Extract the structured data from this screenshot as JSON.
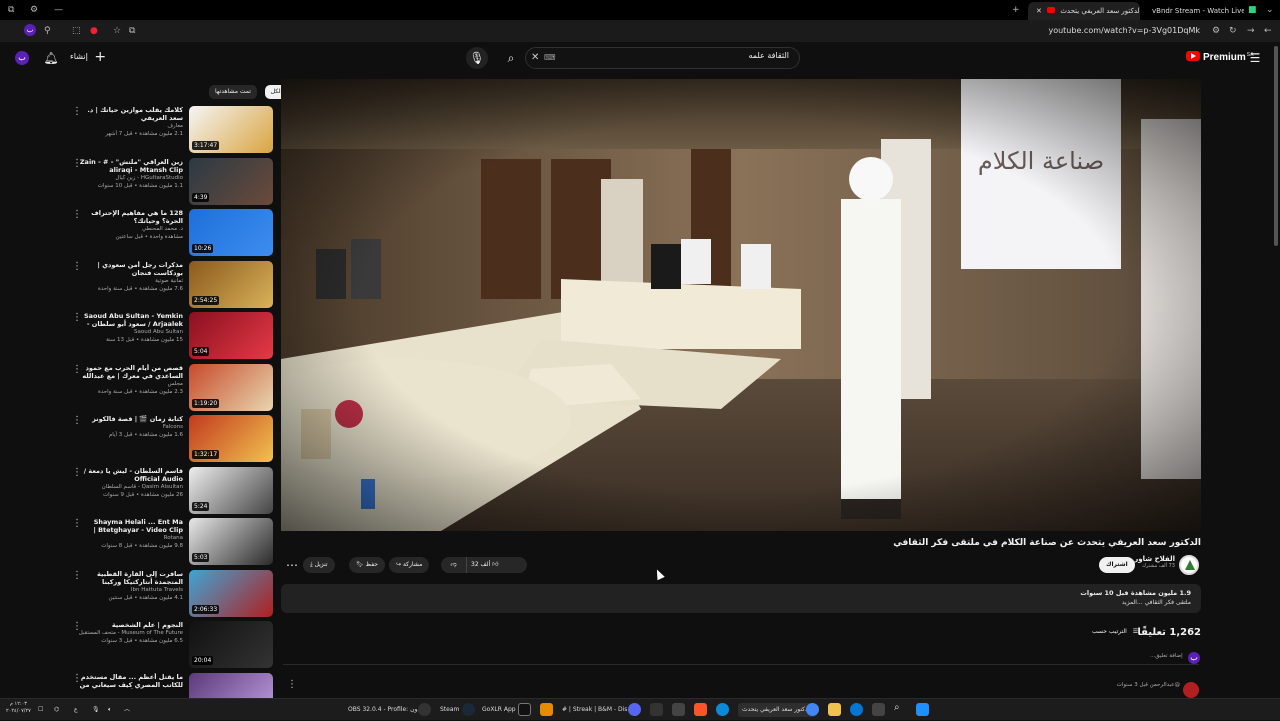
{
  "browser": {
    "tabs": [
      {
        "label": "الدكتور سعد العريفي يتحدث",
        "active": true
      },
      {
        "label": "vBndr Stream - Watch Live on",
        "active": false
      }
    ],
    "url": "youtube.com/watch?v=p-3Vg01DqMk"
  },
  "youtube": {
    "search": {
      "value": "الثقافة علمه",
      "placeholder": "بحث"
    },
    "premium_label": "Premium",
    "premium_region": "SA",
    "create_label": "إنشاء",
    "avatar_letter": "ب",
    "chips": [
      "الكل",
      "تمت مشاهدتها"
    ],
    "video": {
      "title": "الدكتور سعد العريفي يتحدث عن صناعة الكلام في ملتقى فكر الثقافي",
      "channel": "الفلاح شاور",
      "subscribers": "73 ألف مشترك",
      "subscribe_label": "اشتراك",
      "likes": "32 ألف",
      "share_label": "مشاركة",
      "save_label": "حفظ",
      "download_label": "تنزيل",
      "views_line": "1.9 مليون مشاهدة قبل 10 سنوات",
      "desc_line": "ملتقى فكر الثقافي ...المزيد",
      "comments_count": "1,262 تعليقًا",
      "sort_label": "الترتيب حسب",
      "add_comment_placeholder": "إضافة تعليق...",
      "first_comment_author": "@عبدالرحمن قبل 3 سنوات"
    },
    "recommendations": [
      {
        "title": "كلامك يقلب موازين حياتك | د. سعد العريفي",
        "channel": "معارف",
        "stats": "2.1 مليون مشاهدة • قبل 7 أشهر",
        "duration": "3:17:47",
        "colors": [
          "#f5f5f5",
          "#d9a441"
        ]
      },
      {
        "title": "زين العراقي \"ملتش\" - # - Zain aliraqi - Mtansh Clip",
        "channel": "HGultaraStudio - زين كيال",
        "stats": "1.1 مليون مشاهدة • قبل 10 سنوات",
        "duration": "4:39",
        "colors": [
          "#2b3a44",
          "#6b4a3a"
        ]
      },
      {
        "title": "128 ما هي مفاهيم الإحتراف الحرة؟ وحياتك؟",
        "channel": "د. محمد المحنطي",
        "stats": "مشاهدة واحدة • قبل ساعتين",
        "duration": "10:26",
        "colors": [
          "#1e6fd9",
          "#3d8df0"
        ]
      },
      {
        "title": "مذكرات رجل أمن سعودي | بودكاست فنجان",
        "channel": "ثمانية صوتية",
        "stats": "7.6 مليون مشاهدة • قبل سنة واحدة",
        "duration": "2:54:25",
        "colors": [
          "#8a5a1c",
          "#d9b25a"
        ]
      },
      {
        "title": "Saoud Abu Sultan - Yemkin Arjaalek / سعود أبو سلطان - يمكن ارجعلك",
        "channel": "Saoud Abu Sultan",
        "stats": "15 مليون مشاهدة • قبل 13 سنة",
        "duration": "5:04",
        "colors": [
          "#8a1020",
          "#e63946"
        ]
      },
      {
        "title": "قصص من أيام الحرب مع حمود الساعدي في معرك | مع عبدالله الوادي",
        "channel": "مجلس",
        "stats": "2.3 مليون مشاهدة • قبل سنة واحدة",
        "duration": "1:19:20",
        "colors": [
          "#c94a2a",
          "#e8d6b0"
        ]
      },
      {
        "title": "كتابة زمان 🎬 | قصة فالكونز",
        "channel": "Falcons",
        "stats": "1.6 مليون مشاهدة • قبل 3 أيام",
        "duration": "1:32:17",
        "colors": [
          "#c23a1f",
          "#f2c14e"
        ]
      },
      {
        "title": "قاسم السلطان - ليش يا دمعة / Official Audio",
        "channel": "Qasim Alsultan - قاسم السلطان",
        "stats": "26 مليون مشاهدة • قبل 9 سنوات",
        "duration": "5:24",
        "colors": [
          "#eeeeee",
          "#444444"
        ]
      },
      {
        "title": "Shayma Helali ... Ent Ma Btetghayar - Video Clip | شيما",
        "channel": "Rotana",
        "stats": "9.8 مليون مشاهدة • قبل 8 سنوات",
        "duration": "5:03",
        "colors": [
          "#e8e8e8",
          "#2a2a2a"
        ]
      },
      {
        "title": "سافرت إلى القارة القطبية المتجمدة أنتاركتيكا وركبنا الجزيرة كاملة",
        "channel": "Ibn Hattuta Travels",
        "stats": "4.1 مليون مشاهدة • قبل سنتين",
        "duration": "2:06:33",
        "colors": [
          "#3fa4d6",
          "#b02020"
        ]
      },
      {
        "title": "النجوم | علم الشخصية",
        "channel": "Museum of The Future - متحف المستقبل",
        "stats": "6.5 مليون مشاهدة • قبل 3 سنوات",
        "duration": "20:04",
        "colors": [
          "#111111",
          "#333333"
        ]
      },
      {
        "title": "ما يقتل أعظم ... مقال مستخدم للكاتب المصري كيف سيعاني من قصة رجل الذي أصبح...",
        "channel": "",
        "stats": "",
        "duration": "",
        "colors": [
          "#5a3a7a",
          "#c0a0e0"
        ]
      }
    ]
  },
  "taskbar": {
    "time": "١٢:٠٣ م",
    "date": "٢٠٢٤/٠٧/٢٧",
    "items": [
      "OBS 32.0.4 - Profile: بدون",
      "Steam",
      "GoXLR App",
      "# | Streak | B&M - Dis",
      "الدكتور سعد العريفي يتحدث"
    ]
  }
}
